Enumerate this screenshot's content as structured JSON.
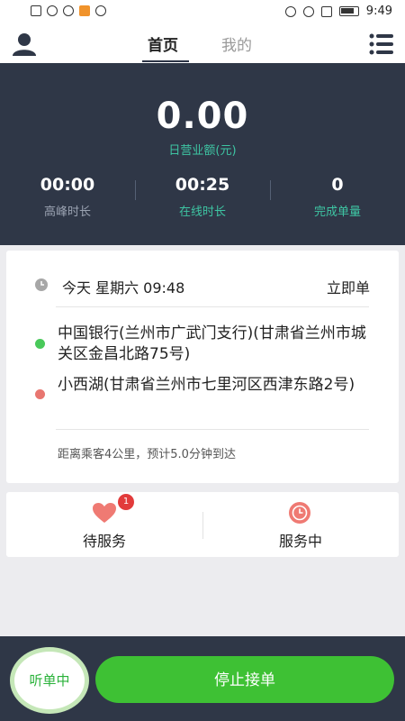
{
  "status_bar": {
    "time": "9:49"
  },
  "nav": {
    "tab_home": "首页",
    "tab_mine": "我的"
  },
  "hero": {
    "income_value": "0.00",
    "income_label": "日营业额(元)",
    "stats": [
      {
        "value": "00:00",
        "label": "高峰时长",
        "label_color": "#9aa2b1"
      },
      {
        "value": "00:25",
        "label": "在线时长",
        "label_color": "#3ec5a3"
      },
      {
        "value": "0",
        "label": "完成单量",
        "label_color": "#3ec5a3"
      }
    ]
  },
  "order": {
    "time": "今天  星期六  09:48",
    "type": "立即单",
    "pickup": "中国银行(兰州市广武门支行)(甘肃省兰州市城关区金昌北路75号)",
    "dropoff": "小西湖(甘肃省兰州市七里河区西津东路2号)",
    "distance": "距离乘客4公里，预计5.0分钟到达",
    "pickup_color": "#49c95a",
    "dropoff_color": "#e87670"
  },
  "services": {
    "pending_label": "待服务",
    "pending_badge": "1",
    "in_service_label": "服务中"
  },
  "bottom": {
    "listen_label": "听单中",
    "stop_label": "停止接单"
  },
  "colors": {
    "dark": "#2f3747",
    "accent_green": "#3ec134",
    "teal": "#3ec5a3",
    "alert_red": "#e23b3b"
  }
}
